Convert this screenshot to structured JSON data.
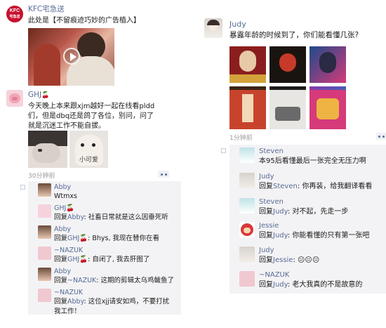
{
  "left": {
    "ad": {
      "name": "KFC宅急送",
      "text": "此处是【不留痕迹巧妙的广告植入】",
      "logo_text": "KFC",
      "logo_sub": "宅急送"
    },
    "post": {
      "name": "GHJ",
      "text_lines": [
        "今天晚上本来跟xjm越好一起在线看pldd",
        "们，但是dbq还是鸽了各位，别问，问了",
        "就是沉迷工作不能自拔。"
      ],
      "time": "30分钟前",
      "image2_text": "小可爱"
    },
    "comments": [
      {
        "name": "Abby",
        "reply_prefix": "",
        "reply_to": "",
        "text": "Wtmxs"
      },
      {
        "name": "GHJ",
        "reply_prefix": "回复",
        "reply_to": "Abby",
        "text": ": 社畜日常就是这么因垂死听"
      },
      {
        "name": "Abby",
        "reply_prefix": "回复",
        "reply_to": "GHJ",
        "text": ": Bhys, 我现在替你在看"
      },
      {
        "name": "~NAZUK",
        "reply_prefix": "回复",
        "reply_to": "GHJ",
        "text": ": 自闭了, 我去肝图了"
      },
      {
        "name": "Abby",
        "reply_prefix": "回复",
        "reply_to": "~NAZUK",
        "text": ": 这期的剪辑太乌鸡鲅鱼了"
      },
      {
        "name": "~NAZUK",
        "reply_prefix": "回复",
        "reply_to": "Abby",
        "text": ": 这位xjj请安如鸡，不要打扰",
        "text2": "我工作！"
      }
    ]
  },
  "right": {
    "post": {
      "name": "Judy",
      "text": "暴露年龄的时候到了，你们能看懂几张?",
      "time": "1分钟前",
      "grid_labels": [
        "",
        "",
        "",
        "",
        "",
        "",
        "",
        "",
        ""
      ]
    },
    "comments": [
      {
        "name": "Steven",
        "reply_prefix": "",
        "reply_to": "",
        "text": "本95后看懂最后一张完全无压力啊"
      },
      {
        "name": "Judy",
        "reply_prefix": "回复",
        "reply_to": "Steven",
        "text": ": 你再装，给我翻译看看"
      },
      {
        "name": "Steven",
        "reply_prefix": "回复",
        "reply_to": "Judy",
        "text": ": 对不起，先走一步"
      },
      {
        "name": "Jessie",
        "reply_prefix": "回复",
        "reply_to": "Judy",
        "text": ": 你能看懂的只有第一张吧"
      },
      {
        "name": "Judy",
        "reply_prefix": "回复",
        "reply_to": "Jessie",
        "text": ": 😐😐😐"
      },
      {
        "name": "~NAZUK",
        "reply_prefix": "回复",
        "reply_to": "Judy",
        "text": ": 老大我真的不是故意的"
      }
    ]
  },
  "colors": {
    "link": "#576b95",
    "kfc_red": "#c8102e",
    "comment_bg": "#f3f3f5"
  }
}
